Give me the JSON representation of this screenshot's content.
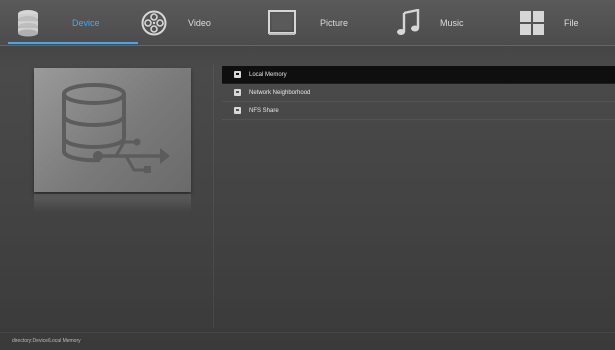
{
  "nav": {
    "tabs": [
      {
        "key": "device",
        "label": "Device",
        "icon": "database-icon",
        "active": true
      },
      {
        "key": "video",
        "label": "Video",
        "icon": "film-reel-icon",
        "active": false
      },
      {
        "key": "picture",
        "label": "Picture",
        "icon": "picture-frame-icon",
        "active": false
      },
      {
        "key": "music",
        "label": "Music",
        "icon": "music-note-icon",
        "active": false
      },
      {
        "key": "file",
        "label": "File",
        "icon": "grid-icon",
        "active": false
      }
    ]
  },
  "preview": {
    "icon": "usb-storage-icon"
  },
  "list": {
    "items": [
      {
        "label": "Local Memory",
        "icon": "drive-icon",
        "selected": true
      },
      {
        "label": "Network Neighborhood",
        "icon": "drive-icon",
        "selected": false
      },
      {
        "label": "NFS Share",
        "icon": "drive-icon",
        "selected": false
      }
    ]
  },
  "status": {
    "path_text": "directory:Device/Local Memory"
  },
  "colors": {
    "accent": "#3fa9f5"
  }
}
